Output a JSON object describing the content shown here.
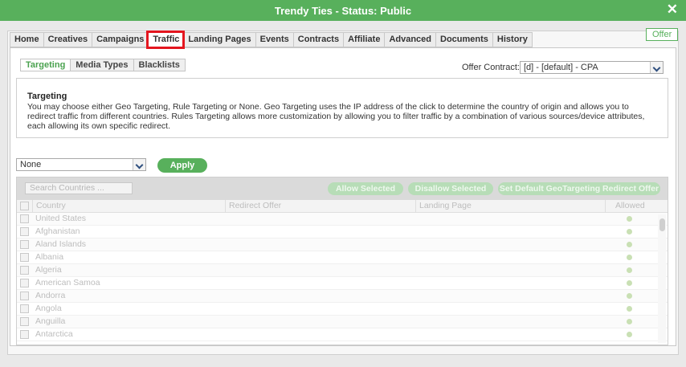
{
  "window": {
    "title": "Trendy Ties - Status: Public"
  },
  "badge": {
    "label": "Offer"
  },
  "tabs": [
    {
      "label": "Home"
    },
    {
      "label": "Creatives"
    },
    {
      "label": "Campaigns"
    },
    {
      "label": "Traffic"
    },
    {
      "label": "Landing Pages"
    },
    {
      "label": "Events"
    },
    {
      "label": "Contracts"
    },
    {
      "label": "Affiliate"
    },
    {
      "label": "Advanced"
    },
    {
      "label": "Documents"
    },
    {
      "label": "History"
    }
  ],
  "subtabs": [
    {
      "label": "Targeting"
    },
    {
      "label": "Media Types"
    },
    {
      "label": "Blacklists"
    }
  ],
  "contract": {
    "label": "Offer Contract:",
    "value": "[d] - [default] - CPA"
  },
  "info": {
    "heading": "Targeting",
    "text": "You may choose either Geo Targeting, Rule Targeting or None. Geo Targeting uses the IP address of the click to determine the country of origin and allows you to redirect traffic from different countries. Rules Targeting allows more customization by allowing you to filter traffic by a combination of various sources/device attributes, each allowing its own specific redirect."
  },
  "targeting_select": {
    "value": "None"
  },
  "apply": {
    "label": "Apply"
  },
  "grid": {
    "search_placeholder": "Search Countries ...",
    "buttons": {
      "allow": "Allow Selected",
      "disallow": "Disallow Selected",
      "default_redirect": "Set Default GeoTargeting Redirect Offer"
    },
    "columns": {
      "country": "Country",
      "redirect": "Redirect Offer",
      "landing": "Landing Page",
      "allowed": "Allowed"
    },
    "rows": [
      {
        "country": "United States"
      },
      {
        "country": "Afghanistan"
      },
      {
        "country": "Aland Islands"
      },
      {
        "country": "Albania"
      },
      {
        "country": "Algeria"
      },
      {
        "country": "American Samoa"
      },
      {
        "country": "Andorra"
      },
      {
        "country": "Angola"
      },
      {
        "country": "Anguilla"
      },
      {
        "country": "Antarctica"
      }
    ]
  },
  "colors": {
    "accent": "#58b05c",
    "highlight": "#e4161f"
  }
}
